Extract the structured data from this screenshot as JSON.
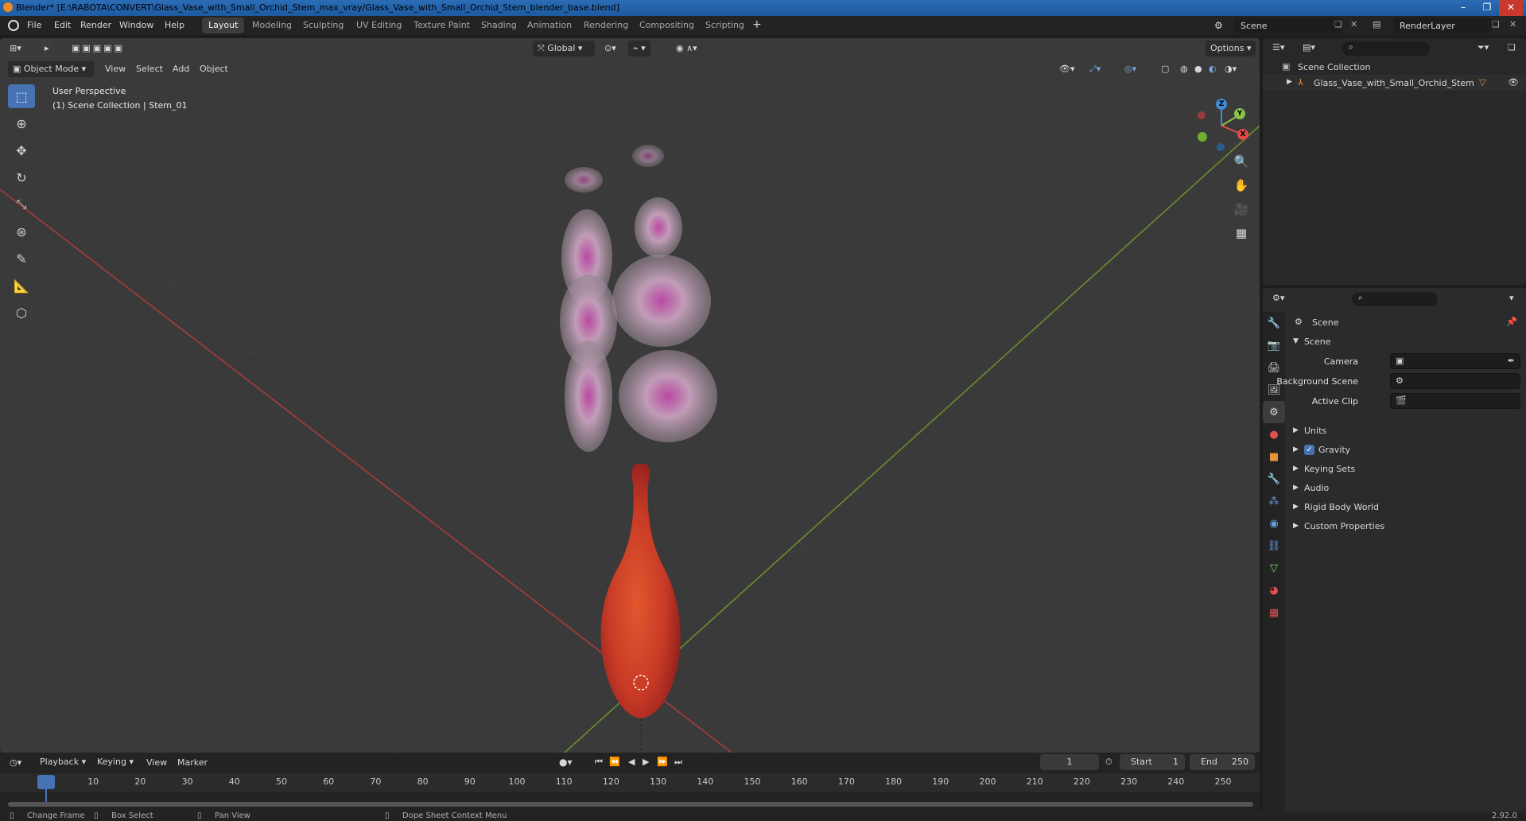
{
  "window": {
    "title": "Blender* [E:\\RABOTA\\CONVERT\\Glass_Vase_with_Small_Orchid_Stem_max_vray/Glass_Vase_with_Small_Orchid_Stem_blender_base.blend]",
    "buttons": [
      "–",
      "❐",
      "✕"
    ]
  },
  "menu": [
    "File",
    "Edit",
    "Render",
    "Window",
    "Help"
  ],
  "workspaces": [
    "Layout",
    "Modeling",
    "Sculpting",
    "UV Editing",
    "Texture Paint",
    "Shading",
    "Animation",
    "Rendering",
    "Compositing",
    "Scripting"
  ],
  "active_workspace": "Layout",
  "scene_selector": "Scene",
  "view_layer": "RenderLayer",
  "viewport": {
    "transform_orientation": "Global",
    "options_label": "Options",
    "mode": "Object Mode",
    "menus": [
      "View",
      "Select",
      "Add",
      "Object"
    ],
    "perspective": "User Perspective",
    "collection_info": "(1) Scene Collection | Stem_01",
    "gizmo": {
      "x": "X",
      "y": "Y",
      "z": "Z"
    }
  },
  "outliner": {
    "root": "Scene Collection",
    "items": [
      "Glass_Vase_with_Small_Orchid_Stem"
    ]
  },
  "properties": {
    "context": "Scene",
    "panel": "Scene",
    "fields": [
      {
        "label": "Camera"
      },
      {
        "label": "Background Scene"
      },
      {
        "label": "Active Clip"
      }
    ],
    "subpanels": [
      "Units",
      "Gravity",
      "Keying Sets",
      "Audio",
      "Rigid Body World",
      "Custom Properties"
    ],
    "gravity_checked": true
  },
  "timeline": {
    "menus": [
      "Playback",
      "Keying",
      "View",
      "Marker"
    ],
    "current_frame": "1",
    "start_label": "Start",
    "start": "1",
    "end_label": "End",
    "end": "250",
    "ticks": [
      "1",
      "10",
      "20",
      "30",
      "40",
      "50",
      "60",
      "70",
      "80",
      "90",
      "100",
      "110",
      "120",
      "130",
      "140",
      "150",
      "160",
      "170",
      "180",
      "190",
      "200",
      "210",
      "220",
      "230",
      "240",
      "250"
    ]
  },
  "statusbar": {
    "items": [
      "Change Frame",
      "Box Select",
      "Pan View",
      "Dope Sheet Context Menu"
    ],
    "version": "2.92.0"
  },
  "colors": {
    "accent": "#4772b3",
    "x_axis": "#e04a4a",
    "y_axis": "#8bc34a",
    "z_axis": "#3f8bd6",
    "vase": "#d0442a"
  }
}
